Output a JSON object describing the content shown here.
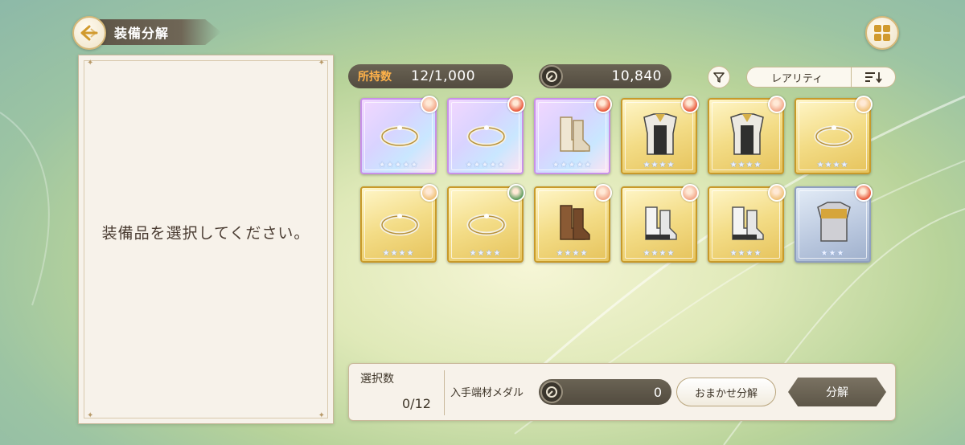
{
  "header": {
    "title": "装備分解",
    "back_icon": "back-arrow-icon",
    "grid_icon": "grid-view-icon"
  },
  "left_panel": {
    "prompt": "装備品を選択してください。"
  },
  "inventory_bar": {
    "owned_label": "所持数",
    "owned_value": "12/1,000",
    "medal_value": "10,840",
    "sort_label": "レアリティ"
  },
  "items": [
    {
      "type": "ring",
      "rarity": 5,
      "stars": "★★★★★",
      "owner_color": "#f2a88a"
    },
    {
      "type": "ring",
      "rarity": 5,
      "stars": "★★★★★",
      "owner_color": "#e8583a"
    },
    {
      "type": "boots",
      "rarity": 5,
      "stars": "★★★★★",
      "owner_color": "#e8583a"
    },
    {
      "type": "armor",
      "rarity": 4,
      "stars": "★★★★",
      "owner_color": "#e8583a"
    },
    {
      "type": "armor",
      "rarity": 4,
      "stars": "★★★★",
      "owner_color": "#f2a88a"
    },
    {
      "type": "ring",
      "rarity": 4,
      "stars": "★★★★",
      "owner_color": "#f0c27a"
    },
    {
      "type": "ring",
      "rarity": 4,
      "stars": "★★★★",
      "owner_color": "#f0c27a"
    },
    {
      "type": "ring",
      "rarity": 4,
      "stars": "★★★★",
      "owner_color": "#5a9a5a"
    },
    {
      "type": "brown-boots",
      "rarity": 4,
      "stars": "★★★★",
      "owner_color": "#f2a88a"
    },
    {
      "type": "white-boots",
      "rarity": 4,
      "stars": "★★★★",
      "owner_color": "#f2a88a"
    },
    {
      "type": "white-boots",
      "rarity": 4,
      "stars": "★★★★",
      "owner_color": "#f0c27a"
    },
    {
      "type": "chestplate",
      "rarity": 3,
      "stars": "★★★",
      "owner_color": "#e8583a"
    }
  ],
  "bottom": {
    "selected_label": "選択数",
    "selected_value": "0/12",
    "obtain_label": "入手端材メダル",
    "obtain_value": "0",
    "auto_button": "おまかせ分解",
    "decompose_button": "分解"
  },
  "colors": {
    "accent_orange": "#ffb24a",
    "pill_dark": "#5c5546",
    "gold": "#d3a93e"
  }
}
